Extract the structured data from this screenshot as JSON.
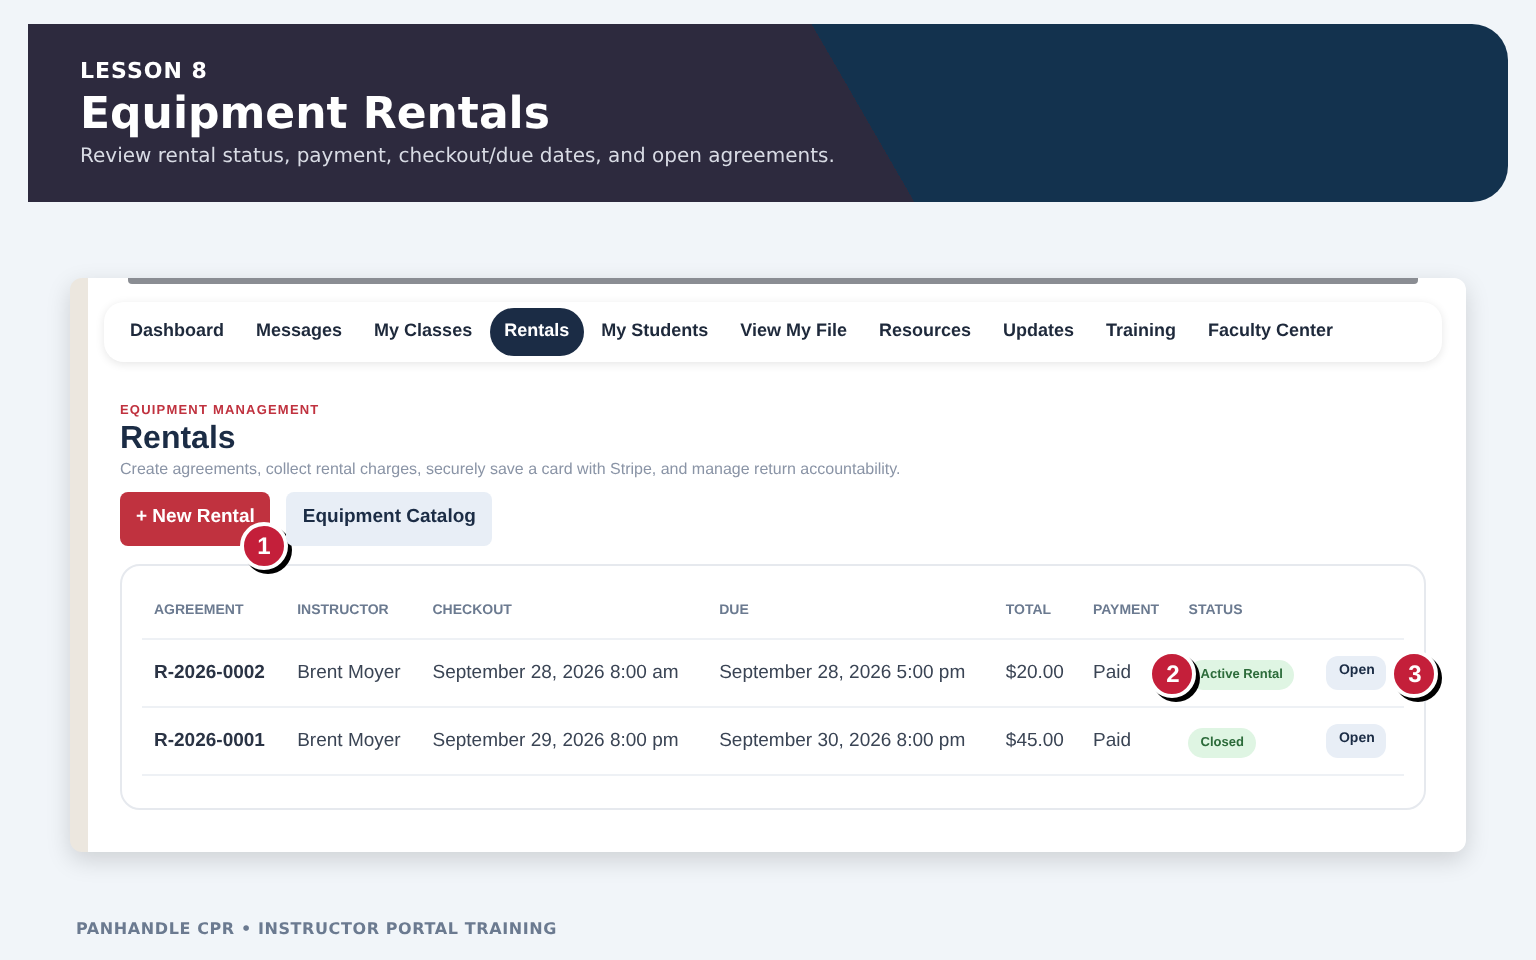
{
  "banner": {
    "eyebrow": "LESSON 8",
    "title": "Equipment Rentals",
    "subtitle": "Review rental status, payment, checkout/due dates, and open agreements."
  },
  "nav": [
    {
      "label": "Dashboard",
      "selected": false
    },
    {
      "label": "Messages",
      "selected": false
    },
    {
      "label": "My Classes",
      "selected": false
    },
    {
      "label": "Rentals",
      "selected": true
    },
    {
      "label": "My Students",
      "selected": false
    },
    {
      "label": "View My File",
      "selected": false
    },
    {
      "label": "Resources",
      "selected": false
    },
    {
      "label": "Updates",
      "selected": false
    },
    {
      "label": "Training",
      "selected": false
    },
    {
      "label": "Faculty Center",
      "selected": false
    }
  ],
  "page": {
    "eyebrow": "EQUIPMENT MANAGEMENT",
    "title": "Rentals",
    "description": "Create agreements, collect rental charges, securely save a card with Stripe, and manage return accountability."
  },
  "buttons": [
    {
      "label": "+ New Rental",
      "kind": "primary",
      "callout": "1"
    },
    {
      "label": "Equipment Catalog",
      "kind": "secondary"
    }
  ],
  "table": {
    "columns": [
      "AGREEMENT",
      "INSTRUCTOR",
      "CHECKOUT",
      "DUE",
      "TOTAL",
      "PAYMENT",
      "STATUS"
    ],
    "rows": [
      {
        "agreement": "R-2026-0002",
        "instructor": "Brent Moyer",
        "checkout": "September 28, 2026 8:00 am",
        "due": "September 28, 2026 5:00 pm",
        "total": "$20.00",
        "payment": "Paid",
        "payment_callout": "2",
        "status": "Active Rental",
        "action": "Open",
        "action_callout": "3"
      },
      {
        "agreement": "R-2026-0001",
        "instructor": "Brent Moyer",
        "checkout": "September 29, 2026 8:00 pm",
        "due": "September 30, 2026 8:00 pm",
        "total": "$45.00",
        "payment": "Paid",
        "status": "Closed",
        "action": "Open"
      }
    ]
  },
  "footer": "PANHANDLE CPR • INSTRUCTOR PORTAL TRAINING"
}
